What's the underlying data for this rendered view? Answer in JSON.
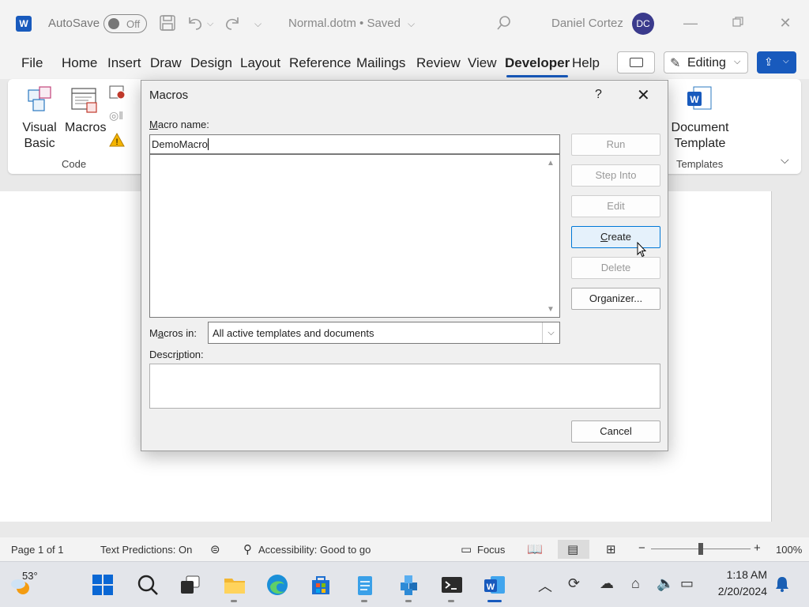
{
  "titlebar": {
    "autosave_label": "AutoSave",
    "autosave_state": "Off",
    "doc_title": "Normal.dotm • Saved",
    "user_name": "Daniel Cortez",
    "user_initials": "DC"
  },
  "ribbon": {
    "tabs": [
      "File",
      "Home",
      "Insert",
      "Draw",
      "Design",
      "Layout",
      "Reference",
      "Mailings",
      "Review",
      "View",
      "Developer",
      "Help"
    ],
    "active_tab": "Developer",
    "editing_label": "Editing",
    "code_group": {
      "visual_basic_label": [
        "Visual",
        "Basic"
      ],
      "macros_label": "Macros",
      "group_label": "Code"
    },
    "templates_group": {
      "document_template_label": [
        "Document",
        "Template"
      ],
      "group_label": "Templates"
    }
  },
  "dialog": {
    "title": "Macros",
    "help_glyph": "?",
    "macro_name_label_underlined": "M",
    "macro_name_label_rest": "acro name:",
    "macro_name_value": "DemoMacro",
    "macros_in_label_pre": "M",
    "macros_in_label_underlined": "a",
    "macros_in_label_rest": "cros in:",
    "macros_in_value": "All active templates and documents",
    "description_label_pre": "Descr",
    "description_label_underlined": "i",
    "description_label_rest": "ption:",
    "buttons": {
      "run": "Run",
      "step_into": "Step Into",
      "edit": "Edit",
      "create_underlined": "C",
      "create_rest": "reate",
      "delete": "Delete",
      "organizer": "Organizer...",
      "cancel": "Cancel"
    }
  },
  "statusbar": {
    "page": "Page 1 of 1",
    "text_predictions": "Text Predictions: On",
    "accessibility": "Accessibility: Good to go",
    "focus": "Focus",
    "zoom": "100%",
    "zoom_level": 1.0
  },
  "taskbar": {
    "temperature": "53°",
    "time": "1:18 AM",
    "date": "2/20/2024"
  },
  "colors": {
    "accent": "#185abd",
    "button_hover": "#e5f1fb"
  }
}
